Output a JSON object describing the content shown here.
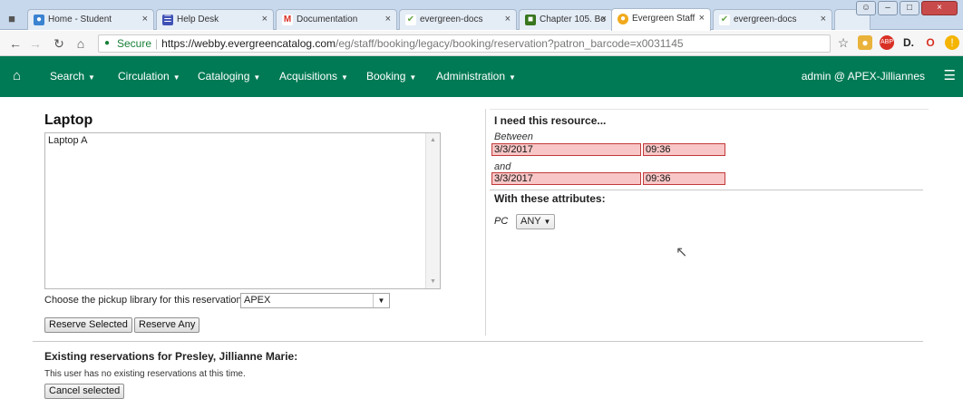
{
  "browser": {
    "tabs": [
      {
        "label": "Home - Student",
        "favicon_color": "#3a83d1",
        "favicon": "●"
      },
      {
        "label": "Help Desk",
        "favicon_color": "#3f51b5",
        "favicon": "☰"
      },
      {
        "label": "Documentation",
        "favicon_color": "#d93025",
        "favicon": "M"
      },
      {
        "label": "evergreen-docs",
        "favicon_color": "#6aa84f",
        "favicon": "✔"
      },
      {
        "label": "Chapter 105. Bo",
        "favicon_color": "#38761d",
        "favicon": "■"
      },
      {
        "label": "Evergreen Staff",
        "favicon_color": "#f1a91c",
        "favicon": "●"
      },
      {
        "label": "evergreen-docs",
        "favicon_color": "#6aa84f",
        "favicon": "✔"
      }
    ],
    "url": {
      "secure_label": "Secure",
      "host": "https://webby.evergreencatalog.com",
      "path": "/eg/staff/booking/legacy/booking/reservation?patron_barcode=x0031145"
    }
  },
  "navbar": {
    "menus": [
      "Search",
      "Circulation",
      "Cataloging",
      "Acquisitions",
      "Booking",
      "Administration"
    ],
    "user": "admin @ APEX-Jilliannes"
  },
  "resource": {
    "title": "Laptop",
    "items": [
      "Laptop A"
    ],
    "pickup_label": "Choose the pickup library for this reservation:",
    "pickup_value": "APEX",
    "reserve_selected": "Reserve Selected",
    "reserve_any": "Reserve Any"
  },
  "need": {
    "heading": "I need this resource...",
    "between_label": "Between",
    "and_label": "and",
    "start_date": "3/3/2017",
    "start_time": "09:36",
    "end_date": "3/3/2017",
    "end_time": "09:36",
    "attributes_heading": "With these attributes:",
    "attr_name": "PC",
    "attr_value": "ANY"
  },
  "existing": {
    "heading": "Existing reservations for Presley, Jillianne Marie:",
    "message": "This user has no existing reservations at this time.",
    "cancel_label": "Cancel selected"
  }
}
